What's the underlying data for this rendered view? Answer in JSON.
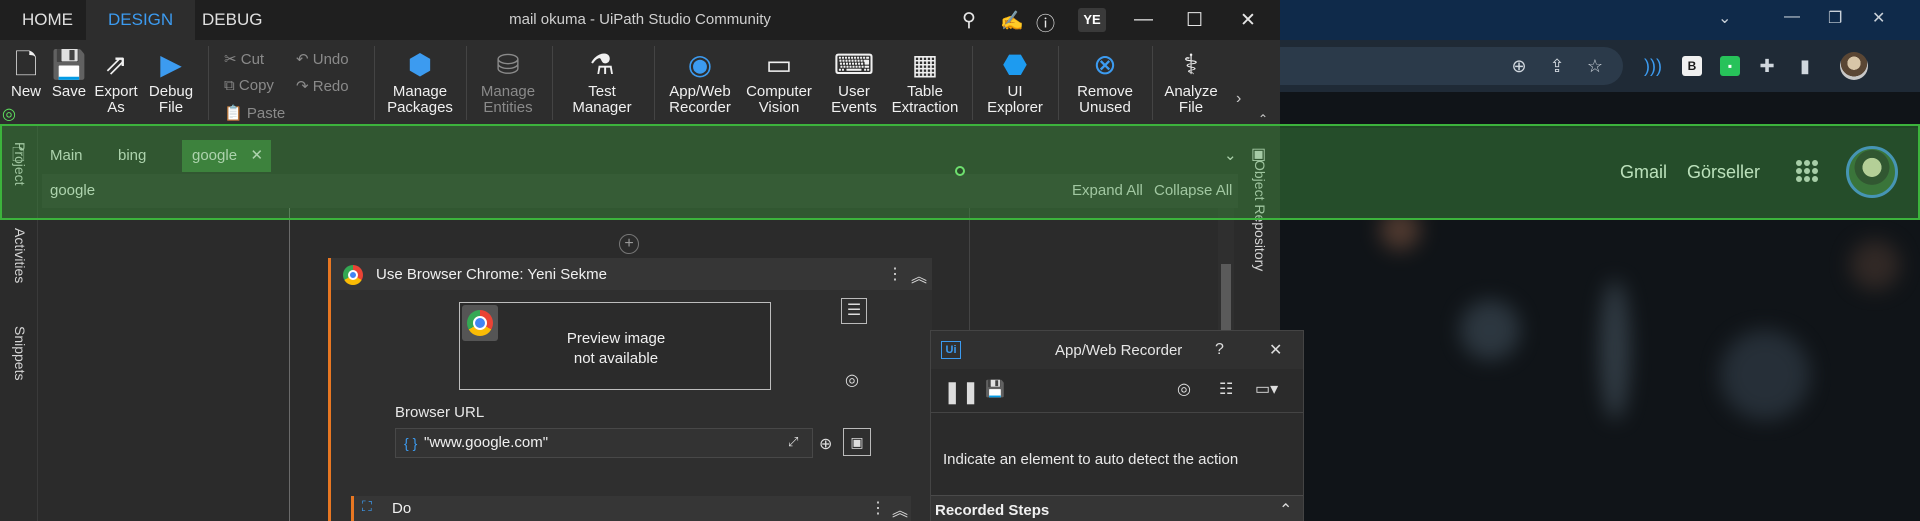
{
  "studio": {
    "menu_tabs": [
      "HOME",
      "DESIGN",
      "DEBUG"
    ],
    "active_tab": "DESIGN",
    "window_title": "mail okuma - UiPath Studio Community",
    "user_initials": "YE"
  },
  "ribbon": {
    "new": "New",
    "save": "Save",
    "export_as_1": "Export",
    "export_as_2": "As",
    "debug_file_1": "Debug",
    "debug_file_2": "File",
    "cut": "Cut",
    "copy": "Copy",
    "paste": "Paste",
    "undo": "Undo",
    "redo": "Redo",
    "manage_packages_1": "Manage",
    "manage_packages_2": "Packages",
    "manage_entities_1": "Manage",
    "manage_entities_2": "Entities",
    "test_manager_1": "Test",
    "test_manager_2": "Manager",
    "app_web_recorder_1": "App/Web",
    "app_web_recorder_2": "Recorder",
    "computer_vision_1": "Computer",
    "computer_vision_2": "Vision",
    "user_events_1": "User",
    "user_events_2": "Events",
    "table_extraction_1": "Table",
    "table_extraction_2": "Extraction",
    "ui_explorer_1": "UI",
    "ui_explorer_2": "Explorer",
    "remove_unused_1": "Remove",
    "remove_unused_2": "Unused",
    "analyze_file_1": "Analyze",
    "analyze_file_2": "File"
  },
  "left_rail": [
    "Project",
    "Activities",
    "Snippets"
  ],
  "right_rail": [
    "Object Repository"
  ],
  "doc_tabs": [
    "Main",
    "bing",
    "google"
  ],
  "active_doc": "google",
  "breadcrumb": {
    "current": "google",
    "expand_all": "Expand All",
    "collapse_all": "Collapse All"
  },
  "activity": {
    "title": "Use Browser Chrome: Yeni Sekme",
    "preview_line1": "Preview image",
    "preview_line2": "not available",
    "url_label": "Browser URL",
    "url_brace": "{ }",
    "url_value": "\"www.google.com\"",
    "do_label": "Do"
  },
  "recorder": {
    "title": "App/Web Recorder",
    "help": "?",
    "message": "Indicate an element to auto detect the action",
    "recorded_steps": "Recorded Steps",
    "badge": "Ui"
  },
  "browser": {
    "google_links": [
      "Gmail",
      "Görseller"
    ],
    "ext_b": "B"
  },
  "colors": {
    "accent": "#3c9bf0",
    "highlight": "#3cb33c",
    "activity_border": "#e87722"
  }
}
